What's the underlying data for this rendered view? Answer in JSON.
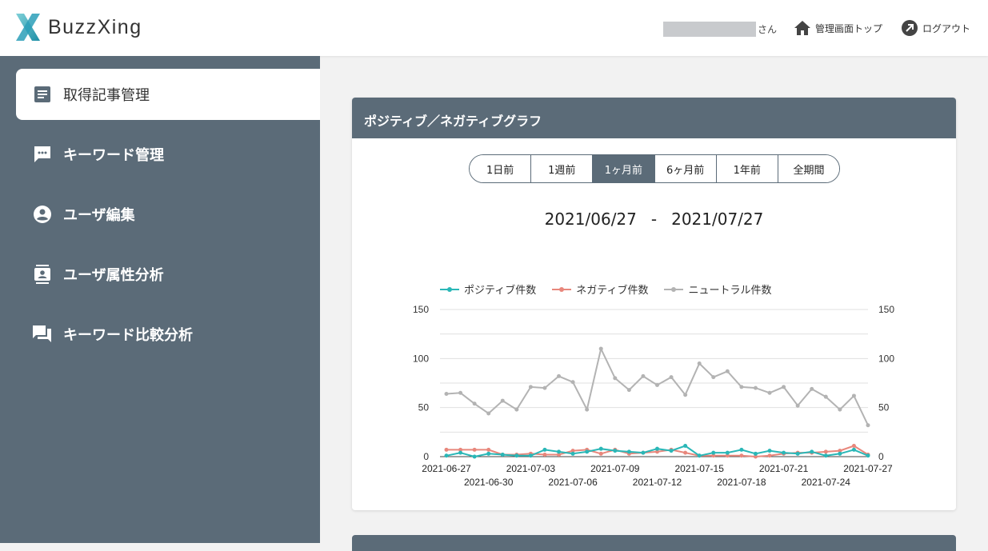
{
  "brand": {
    "name": "BuzzXing"
  },
  "header": {
    "user_suffix": "さん",
    "home_label": "管理画面トップ",
    "logout_label": "ログアウト"
  },
  "sidebar": {
    "items": [
      {
        "label": "取得記事管理",
        "icon": "article-icon",
        "active": true
      },
      {
        "label": "キーワード管理",
        "icon": "chat-bubble-icon",
        "active": false
      },
      {
        "label": "ユーザ編集",
        "icon": "account-circle-icon",
        "active": false
      },
      {
        "label": "ユーザ属性分析",
        "icon": "contact-card-icon",
        "active": false
      },
      {
        "label": "キーワード比較分析",
        "icon": "forum-icon",
        "active": false
      }
    ]
  },
  "card": {
    "title": "ポジティブ／ネガティブグラフ",
    "range_buttons": [
      "1日前",
      "1週前",
      "1ヶ月前",
      "6ヶ月前",
      "1年前",
      "全期間"
    ],
    "active_range": "1ヶ月前",
    "date_from": "2021/06/27",
    "date_sep": "-",
    "date_to": "2021/07/27"
  },
  "colors": {
    "sidebar": "#5b6b78",
    "positive": "#2ab7b7",
    "negative": "#e8877c",
    "neutral": "#b3b3b3"
  },
  "chart_data": {
    "type": "line",
    "x": [
      "2021-06-27",
      "2021-06-28",
      "2021-06-29",
      "2021-06-30",
      "2021-07-01",
      "2021-07-02",
      "2021-07-03",
      "2021-07-04",
      "2021-07-05",
      "2021-07-06",
      "2021-07-07",
      "2021-07-08",
      "2021-07-09",
      "2021-07-10",
      "2021-07-11",
      "2021-07-12",
      "2021-07-13",
      "2021-07-14",
      "2021-07-15",
      "2021-07-16",
      "2021-07-17",
      "2021-07-18",
      "2021-07-19",
      "2021-07-20",
      "2021-07-21",
      "2021-07-22",
      "2021-07-23",
      "2021-07-24",
      "2021-07-25",
      "2021-07-26",
      "2021-07-27"
    ],
    "x_tick_labels": [
      "2021-06-27",
      "2021-06-30",
      "2021-07-03",
      "2021-07-06",
      "2021-07-09",
      "2021-07-12",
      "2021-07-15",
      "2021-07-18",
      "2021-07-21",
      "2021-07-24",
      "2021-07-27"
    ],
    "series": [
      {
        "name": "ポジティブ件数",
        "color": "#2ab7b7",
        "values": [
          1,
          4,
          0,
          3,
          2,
          1,
          1,
          7,
          5,
          3,
          5,
          8,
          6,
          5,
          4,
          8,
          6,
          11,
          1,
          4,
          4,
          7,
          3,
          6,
          4,
          3,
          5,
          1,
          3,
          7,
          1
        ]
      },
      {
        "name": "ネガティブ件数",
        "color": "#e8877c",
        "values": [
          7,
          7,
          7,
          7,
          2,
          2,
          3,
          2,
          2,
          6,
          7,
          3,
          7,
          3,
          4,
          5,
          7,
          4,
          1,
          1,
          1,
          1,
          0,
          1,
          3,
          4,
          4,
          5,
          6,
          11,
          2
        ]
      },
      {
        "name": "ニュートラル件数",
        "color": "#b3b3b3",
        "values": [
          64,
          65,
          54,
          44,
          57,
          48,
          71,
          70,
          82,
          76,
          48,
          110,
          80,
          68,
          82,
          73,
          81,
          63,
          95,
          81,
          87,
          71,
          70,
          65,
          71,
          52,
          69,
          61,
          48,
          62,
          32
        ]
      }
    ],
    "ylim": [
      0,
      150
    ],
    "y_ticks": [
      0,
      50,
      100,
      150
    ],
    "legend_position": "top",
    "grid": true
  }
}
